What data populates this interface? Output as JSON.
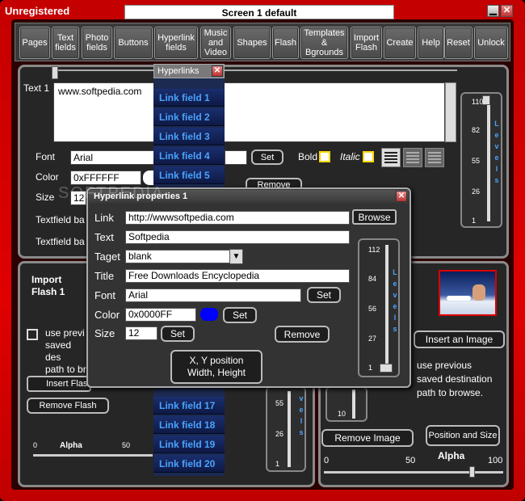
{
  "window": {
    "title": "Unregistered",
    "screen": "Screen 1 default"
  },
  "toolbar": {
    "buttons": [
      "Pages",
      "Text\nfields",
      "Photo\nfields",
      "Buttons",
      "Hyperlink\nfields",
      "Music\nand\nVideo",
      "Shapes",
      "Flash",
      "Templates\n&\nBgrounds",
      "Import\nFlash",
      "Create",
      "Help",
      "Reset",
      "Unlock"
    ]
  },
  "text_panel": {
    "label": "Text 1",
    "text_value": "www.softpedia.com",
    "font_label": "Font",
    "font_value": "Arial",
    "set_label": "Set",
    "color_label": "Color",
    "color_value": "0xFFFFFF",
    "size_label": "Size",
    "size_value": "12",
    "bold_label": "Bold",
    "italic_label": "Italic",
    "remove_label": "Remove",
    "bg_label_1": "Textfield ba",
    "bg_label_2": "Textfield ba",
    "levels_ticks": [
      "110",
      "82",
      "55",
      "26",
      "1"
    ],
    "levels_label": "Levels"
  },
  "hyperlinks_panel": {
    "title": "Hyperlinks",
    "items_top": [
      "Link field 1",
      "Link field 2",
      "Link field 3",
      "Link field 4",
      "Link field 5"
    ],
    "items_bottom": [
      "Link field 17",
      "Link field 18",
      "Link field 19",
      "Link field 20"
    ]
  },
  "dialog": {
    "title": "Hyperlink properties 1",
    "link_label": "Link",
    "link_value": "http://wwwsoftpedia.com",
    "browse_label": "Browse",
    "text_label": "Text",
    "text_value": "Softpedia",
    "target_label": "Taget",
    "target_value": "blank",
    "title_label": "Title",
    "title_value": "Free Downloads Encyclopedia",
    "font_label": "Font",
    "font_value": "Arial",
    "set_label": "Set",
    "color_label": "Color",
    "color_value": "0x0000FF",
    "swatch_color": "#0000ff",
    "size_label": "Size",
    "size_value": "12",
    "remove_label": "Remove",
    "position_label": "X, Y position\nWidth, Height",
    "levels_ticks": [
      "112",
      "84",
      "56",
      "27",
      "1"
    ],
    "levels_label": "Levels"
  },
  "flash_panel": {
    "title": "Import\nFlash 1",
    "use_previous": "use previ\nsaved des\npath to br",
    "insert_label": "Insert Flas",
    "remove_label": "Remove Flash",
    "alpha_label": "Alpha",
    "alpha_ticks": [
      "0",
      "50"
    ],
    "levels_ticks": [
      "55",
      "26",
      "1"
    ],
    "levels_label": "vels"
  },
  "image_panel": {
    "insert_label": "Insert an Image",
    "use_previous": "use previous\nsaved destination\npath to browse.",
    "remove_label": "Remove Image",
    "position_label": "Position and Size",
    "alpha_label": "Alpha",
    "alpha_ticks": [
      "0",
      "50",
      "100"
    ],
    "level_tick": "10"
  },
  "watermark": "SOFTPEDIA"
}
